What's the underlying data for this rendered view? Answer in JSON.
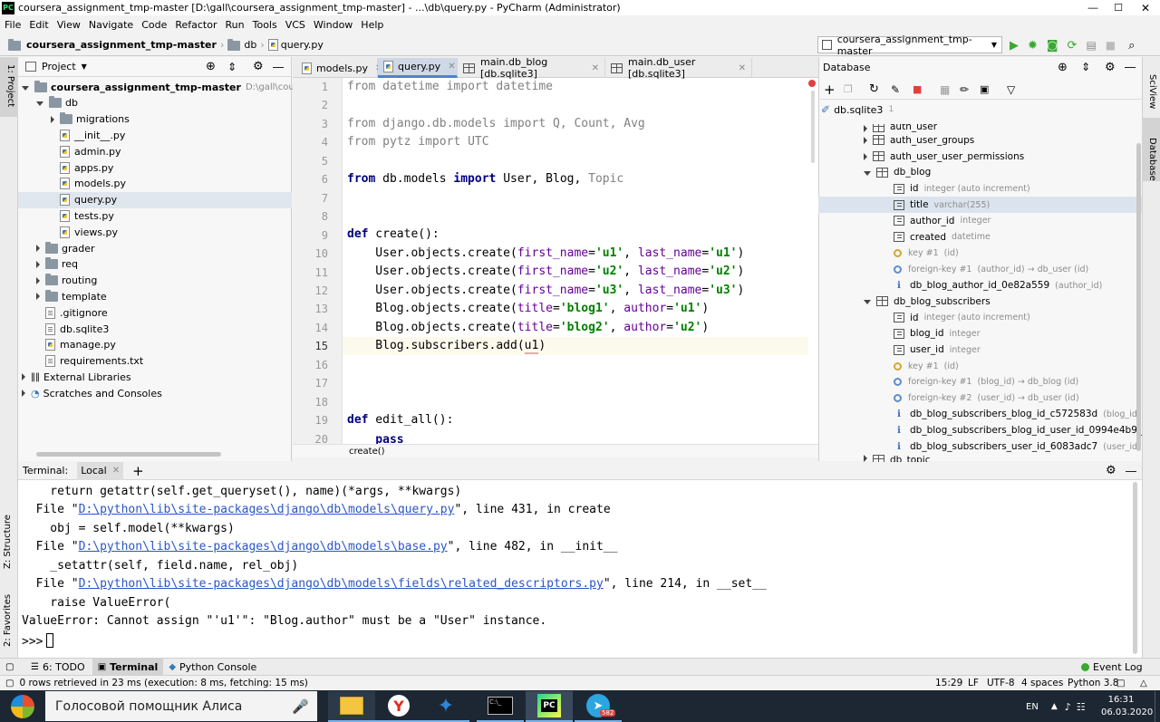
{
  "window": {
    "title": "coursera_assignment_tmp-master [D:\\gall\\coursera_assignment_tmp-master] - ...\\db\\query.py - PyCharm (Administrator)",
    "app_icon": "PC"
  },
  "menu": [
    "File",
    "Edit",
    "View",
    "Navigate",
    "Code",
    "Refactor",
    "Run",
    "Tools",
    "VCS",
    "Window",
    "Help"
  ],
  "breadcrumb": {
    "project": "coursera_assignment_tmp-master",
    "folder": "db",
    "file": "query.py"
  },
  "run_config": "coursera_assignment_tmp-master",
  "side_left": {
    "project": "1: Project",
    "structure": "Z: Structure",
    "favorites": "2: Favorites"
  },
  "side_right": {
    "sciview": "SciView",
    "database": "Database"
  },
  "project_panel": {
    "title": "Project",
    "items": [
      {
        "label": "coursera_assignment_tmp-master",
        "extra": "D:\\gall\\coursera_assignment_tmp-master",
        "kind": "folder",
        "state": "open"
      },
      {
        "label": "db",
        "kind": "folder",
        "state": "open"
      },
      {
        "label": "migrations",
        "kind": "folder",
        "state": "closed"
      },
      {
        "label": "__init__.py",
        "kind": "py"
      },
      {
        "label": "admin.py",
        "kind": "py"
      },
      {
        "label": "apps.py",
        "kind": "py"
      },
      {
        "label": "models.py",
        "kind": "py"
      },
      {
        "label": "query.py",
        "kind": "py"
      },
      {
        "label": "tests.py",
        "kind": "py"
      },
      {
        "label": "views.py",
        "kind": "py"
      },
      {
        "label": "grader",
        "kind": "folder",
        "state": "closed"
      },
      {
        "label": "req",
        "kind": "folder",
        "state": "closed"
      },
      {
        "label": "routing",
        "kind": "folder",
        "state": "closed"
      },
      {
        "label": "template",
        "kind": "folder",
        "state": "closed"
      },
      {
        "label": ".gitignore",
        "kind": "txt"
      },
      {
        "label": "db.sqlite3",
        "kind": "txt"
      },
      {
        "label": "manage.py",
        "kind": "py"
      },
      {
        "label": "requirements.txt",
        "kind": "txt"
      },
      {
        "label": "External Libraries",
        "kind": "lib",
        "state": "closed"
      },
      {
        "label": "Scratches and Consoles",
        "kind": "scratch",
        "state": "closed"
      }
    ]
  },
  "editor_tabs": [
    {
      "label": "models.py",
      "active": false
    },
    {
      "label": "query.py",
      "active": true
    },
    {
      "label": "main.db_blog [db.sqlite3]",
      "active": false
    },
    {
      "label": "main.db_user [db.sqlite3]",
      "active": false
    }
  ],
  "code": {
    "line_numbers": [
      "1",
      "2",
      "3",
      "4",
      "5",
      "6",
      "7",
      "8",
      "9",
      "10",
      "11",
      "12",
      "13",
      "14",
      "15",
      "16",
      "17",
      "18",
      "19",
      "20"
    ],
    "l1": {
      "a": "from",
      "b": " datetime ",
      "c": "import",
      "d": " datetime"
    },
    "l3": {
      "a": "from",
      "b": " django.db.models ",
      "c": "import",
      "d": " Q, Count, Avg"
    },
    "l4": {
      "a": "from",
      "b": " pytz ",
      "c": "import",
      "d": " UTC"
    },
    "l6": {
      "a": "from",
      "b": " db.models ",
      "c": "import",
      "d": " User, Blog, ",
      "e": "Topic"
    },
    "l9": {
      "a": "def",
      "b": " create():"
    },
    "l10": {
      "a": "    User.objects.create(",
      "b": "first_name",
      "c": "=",
      "d": "'u1'",
      "e": ", ",
      "f": "last_name",
      "g": "=",
      "h": "'u1'",
      "i": ")"
    },
    "l11": {
      "a": "    User.objects.create(",
      "b": "first_name",
      "c": "=",
      "d": "'u2'",
      "e": ", ",
      "f": "last_name",
      "g": "=",
      "h": "'u2'",
      "i": ")"
    },
    "l12": {
      "a": "    User.objects.create(",
      "b": "first_name",
      "c": "=",
      "d": "'u3'",
      "e": ", ",
      "f": "last_name",
      "g": "=",
      "h": "'u3'",
      "i": ")"
    },
    "l13": {
      "a": "    Blog.objects.create(",
      "b": "title",
      "c": "=",
      "d": "'blog1'",
      "e": ", ",
      "f": "author",
      "g": "=",
      "h": "'u1'",
      "i": ")"
    },
    "l14": {
      "a": "    Blog.objects.create(",
      "b": "title",
      "c": "=",
      "d": "'blog2'",
      "e": ", ",
      "f": "author",
      "g": "=",
      "h": "'u2'",
      "i": ")"
    },
    "l15": {
      "a": "    Blog.subscribers.add(",
      "b": "u1",
      "c": ")"
    },
    "l19": {
      "a": "def",
      "b": " edit_all():"
    },
    "l20": {
      "a": "    pass"
    },
    "status_crumb": "create()"
  },
  "database": {
    "title": "Database",
    "root": "db.sqlite3",
    "root_count": "1",
    "items": [
      {
        "label": "auth_user",
        "type": "",
        "kind": "table",
        "partial": true
      },
      {
        "label": "auth_user_groups",
        "type": "",
        "kind": "table"
      },
      {
        "label": "auth_user_user_permissions",
        "type": "",
        "kind": "table"
      },
      {
        "label": "db_blog",
        "type": "",
        "kind": "table",
        "open": true
      },
      {
        "label": "id",
        "type": "integer (auto increment)",
        "kind": "col"
      },
      {
        "label": "title",
        "type": "varchar(255)",
        "kind": "col",
        "selected": true
      },
      {
        "label": "author_id",
        "type": "integer",
        "kind": "col"
      },
      {
        "label": "created",
        "type": "datetime",
        "kind": "col"
      },
      {
        "label": "key #1",
        "type": "(id)",
        "kind": "key"
      },
      {
        "label": "foreign-key #1",
        "type": "(author_id) → db_user (id)",
        "kind": "fkey"
      },
      {
        "label": "db_blog_author_id_0e82a559",
        "type": "(author_id)",
        "kind": "idx"
      },
      {
        "label": "db_blog_subscribers",
        "type": "",
        "kind": "table",
        "open": true
      },
      {
        "label": "id",
        "type": "integer (auto increment)",
        "kind": "col"
      },
      {
        "label": "blog_id",
        "type": "integer",
        "kind": "col"
      },
      {
        "label": "user_id",
        "type": "integer",
        "kind": "col"
      },
      {
        "label": "key #1",
        "type": "(id)",
        "kind": "key"
      },
      {
        "label": "foreign-key #1",
        "type": "(blog_id) → db_blog (id)",
        "kind": "fkey"
      },
      {
        "label": "foreign-key #2",
        "type": "(user_id) → db_user (id)",
        "kind": "fkey"
      },
      {
        "label": "db_blog_subscribers_blog_id_c572583d",
        "type": "(blog_id)",
        "kind": "idx"
      },
      {
        "label": "db_blog_subscribers_blog_id_user_id_0994e4b9_uniq",
        "type": "",
        "kind": "idxu"
      },
      {
        "label": "db_blog_subscribers_user_id_6083adc7",
        "type": "(user_id)",
        "kind": "idx"
      },
      {
        "label": "db_topic",
        "type": "",
        "kind": "table",
        "partial": true
      }
    ]
  },
  "terminal": {
    "label": "Terminal:",
    "tab": "Local",
    "lines": {
      "t1": "    return getattr(self.get_queryset(), name)(*args, **kwargs)",
      "t2a": "  File \"",
      "t2b": "D:\\python\\lib\\site-packages\\django\\db\\models\\query.py",
      "t2c": "\", line 431, in create",
      "t3": "    obj = self.model(**kwargs)",
      "t4a": "  File \"",
      "t4b": "D:\\python\\lib\\site-packages\\django\\db\\models\\base.py",
      "t4c": "\", line 482, in __init__",
      "t5": "    _setattr(self, field.name, rel_obj)",
      "t6a": "  File \"",
      "t6b": "D:\\python\\lib\\site-packages\\django\\db\\models\\fields\\related_descriptors.py",
      "t6c": "\", line 214, in __set__",
      "t7": "    raise ValueError(",
      "t8": "ValueError: Cannot assign \"'u1'\": \"Blog.author\" must be a \"User\" instance.",
      "t9": ">>> "
    }
  },
  "bottom_tabs": [
    {
      "label": "6: TODO"
    },
    {
      "label": "Terminal"
    },
    {
      "label": "Python Console"
    }
  ],
  "event_log": "Event Log",
  "status": {
    "message": "0 rows retrieved in 23 ms (execution: 8 ms, fetching: 15 ms)",
    "position": "15:29",
    "line_sep": "LF",
    "encoding": "UTF-8",
    "indent": "4 spaces",
    "interpreter": "Python 3.8"
  },
  "taskbar": {
    "search": "Голосовой помощник Алиса",
    "lang": "EN",
    "time": "16:31",
    "date": "06.03.2020",
    "badge": "582"
  }
}
